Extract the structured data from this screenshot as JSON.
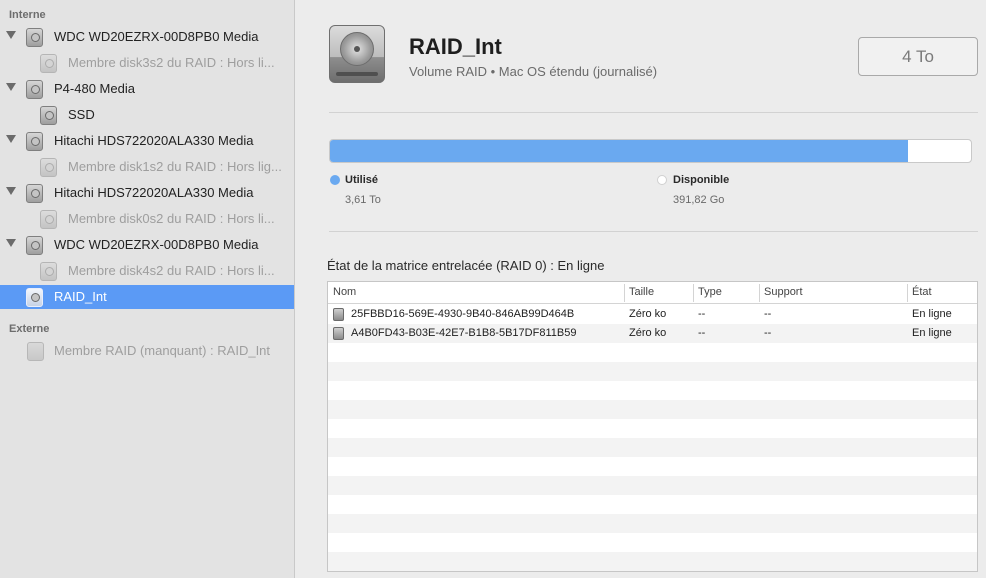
{
  "sidebar": {
    "internal_title": "Interne",
    "external_title": "Externe",
    "items": [
      {
        "label": "WDC WD20EZRX-00D8PB0 Media",
        "level": 0,
        "disclosure": true,
        "dim": false,
        "selected": false
      },
      {
        "label": "Membre disk3s2 du RAID : Hors li...",
        "level": 1,
        "disclosure": false,
        "dim": true,
        "selected": false
      },
      {
        "label": "P4-480 Media",
        "level": 0,
        "disclosure": true,
        "dim": false,
        "selected": false
      },
      {
        "label": "SSD",
        "level": 1,
        "disclosure": false,
        "dim": false,
        "selected": false
      },
      {
        "label": "Hitachi HDS722020ALA330 Media",
        "level": 0,
        "disclosure": true,
        "dim": false,
        "selected": false
      },
      {
        "label": "Membre disk1s2 du RAID : Hors lig...",
        "level": 1,
        "disclosure": false,
        "dim": true,
        "selected": false
      },
      {
        "label": "Hitachi HDS722020ALA330 Media",
        "level": 0,
        "disclosure": true,
        "dim": false,
        "selected": false
      },
      {
        "label": "Membre disk0s2 du RAID : Hors li...",
        "level": 1,
        "disclosure": false,
        "dim": true,
        "selected": false
      },
      {
        "label": "WDC WD20EZRX-00D8PB0 Media",
        "level": 0,
        "disclosure": true,
        "dim": false,
        "selected": false
      },
      {
        "label": "Membre disk4s2 du RAID : Hors li...",
        "level": 1,
        "disclosure": false,
        "dim": true,
        "selected": false
      },
      {
        "label": "RAID_Int",
        "level": 0,
        "disclosure": false,
        "dim": false,
        "selected": true
      }
    ],
    "external_items": [
      {
        "label": "Membre RAID (manquant) : RAID_Int"
      }
    ]
  },
  "volume": {
    "name": "RAID_Int",
    "subtitle": "Volume RAID • Mac OS étendu (journalisé)",
    "capacity": "4 To"
  },
  "usage": {
    "used_fraction": 0.902,
    "used_label": "Utilisé",
    "used_value": "3,61 To",
    "free_label": "Disponible",
    "free_value": "391,82 Go",
    "used_color": "#6aa9f0",
    "free_color": "#ffffff"
  },
  "matrix_state": "État de la matrice entrelacée (RAID 0) : En ligne",
  "table": {
    "columns": [
      "Nom",
      "Taille",
      "Type",
      "Support",
      "État"
    ],
    "rows": [
      [
        "25FBBD16-569E-4930-9B40-846AB99D464B",
        "Zéro ko",
        "--",
        "--",
        "En ligne"
      ],
      [
        "A4B0FD43-B03E-42E7-B1B8-5B17DF811B59",
        "Zéro ko",
        "--",
        "--",
        "En ligne"
      ]
    ]
  }
}
